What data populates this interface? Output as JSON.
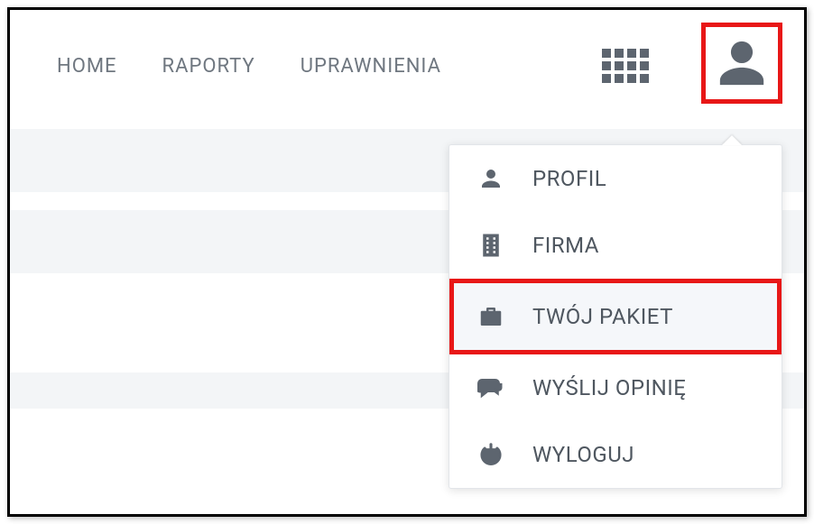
{
  "nav": {
    "home": "HOME",
    "reports": "RAPORTY",
    "permissions": "UPRAWNIENIA"
  },
  "userMenu": {
    "profile": "PROFIL",
    "company": "FIRMA",
    "package": "TWÓJ PAKIET",
    "feedback": "WYŚLIJ OPINIĘ",
    "logout": "WYLOGUJ"
  }
}
